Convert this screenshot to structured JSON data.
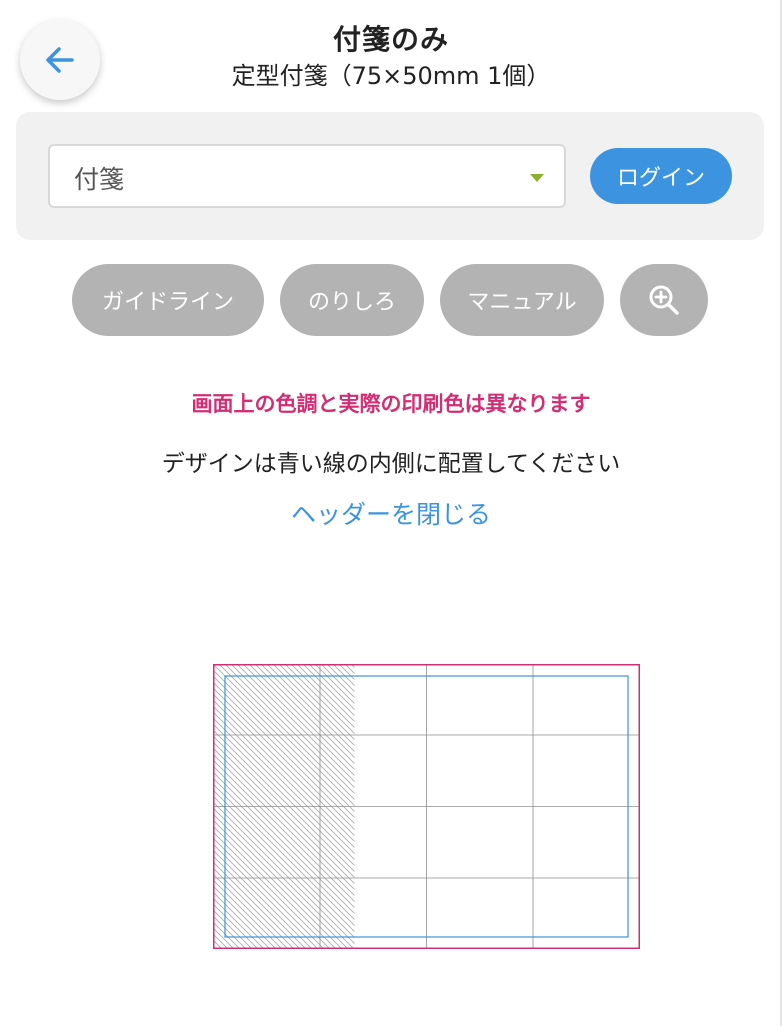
{
  "header": {
    "title": "付箋のみ",
    "subtitle": "定型付箋（75×50mm 1個）",
    "back_icon": "arrow-left-icon"
  },
  "product_select": {
    "value": "付箋",
    "caret_color": "#8ab22c"
  },
  "login": {
    "label": "ログイン"
  },
  "tools": {
    "guideline_label": "ガイドライン",
    "nori_label": "のりしろ",
    "manual_label": "マニュアル",
    "zoom_icon": "zoom-in-icon"
  },
  "notices": {
    "color_warning": "画面上の色調と実際の印刷色は異なります",
    "design_instruction": "デザインは青い線の内側に配置してください",
    "close_header_link": "ヘッダーを閉じる"
  },
  "colors": {
    "accent_blue": "#3c94e0",
    "warning_pink": "#d32e74",
    "bleed_line": "#d32e74",
    "safe_line": "#3c94e0",
    "pill_gray": "#b3b3b3"
  }
}
